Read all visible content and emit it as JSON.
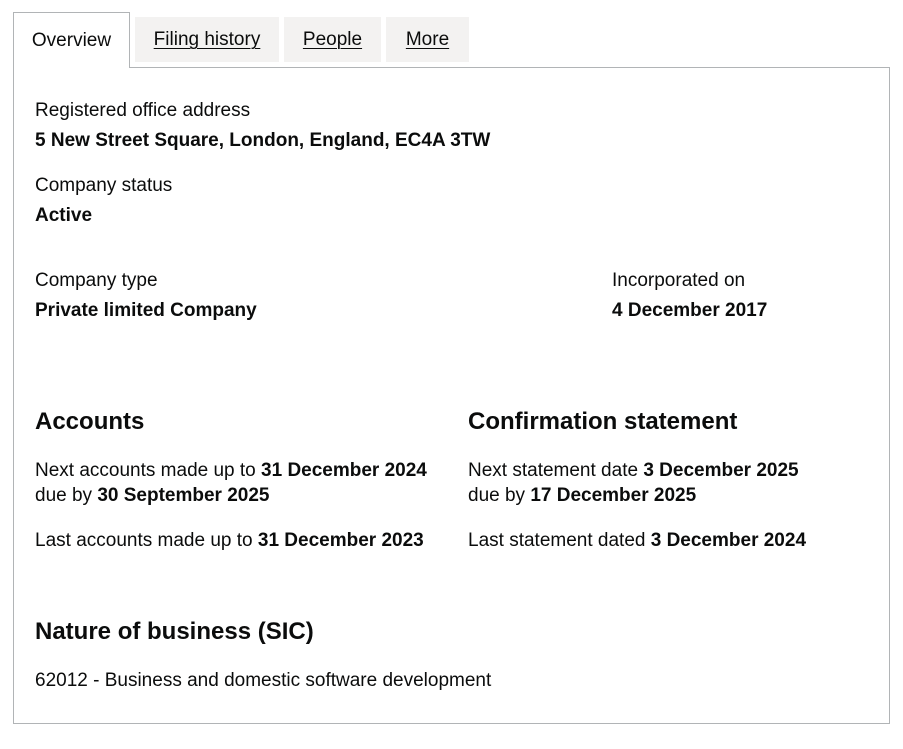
{
  "tabs": [
    {
      "label": "Overview",
      "active": true
    },
    {
      "label": "Filing history",
      "active": false
    },
    {
      "label": "People",
      "active": false
    },
    {
      "label": "More",
      "active": false
    }
  ],
  "overview": {
    "registered_office": {
      "label": "Registered office address",
      "value": "5 New Street Square, London, England, EC4A 3TW"
    },
    "company_status": {
      "label": "Company status",
      "value": "Active"
    },
    "company_type": {
      "label": "Company type",
      "value": "Private limited Company"
    },
    "incorporated": {
      "label": "Incorporated on",
      "value": "4 December 2017"
    }
  },
  "accounts": {
    "heading": "Accounts",
    "next_prefix": "Next accounts made up to",
    "next_date": "31 December 2024",
    "due_prefix": "due by",
    "due_date": "30 September 2025",
    "last_prefix": "Last accounts made up to",
    "last_date": "31 December 2023"
  },
  "confirmation": {
    "heading": "Confirmation statement",
    "next_prefix": "Next statement date",
    "next_date": "3 December 2025",
    "due_prefix": "due by",
    "due_date": "17 December 2025",
    "last_prefix": "Last statement dated",
    "last_date": "3 December 2024"
  },
  "nature_of_business": {
    "heading": "Nature of business (SIC)",
    "items": [
      "62012 - Business and domestic software development"
    ]
  }
}
